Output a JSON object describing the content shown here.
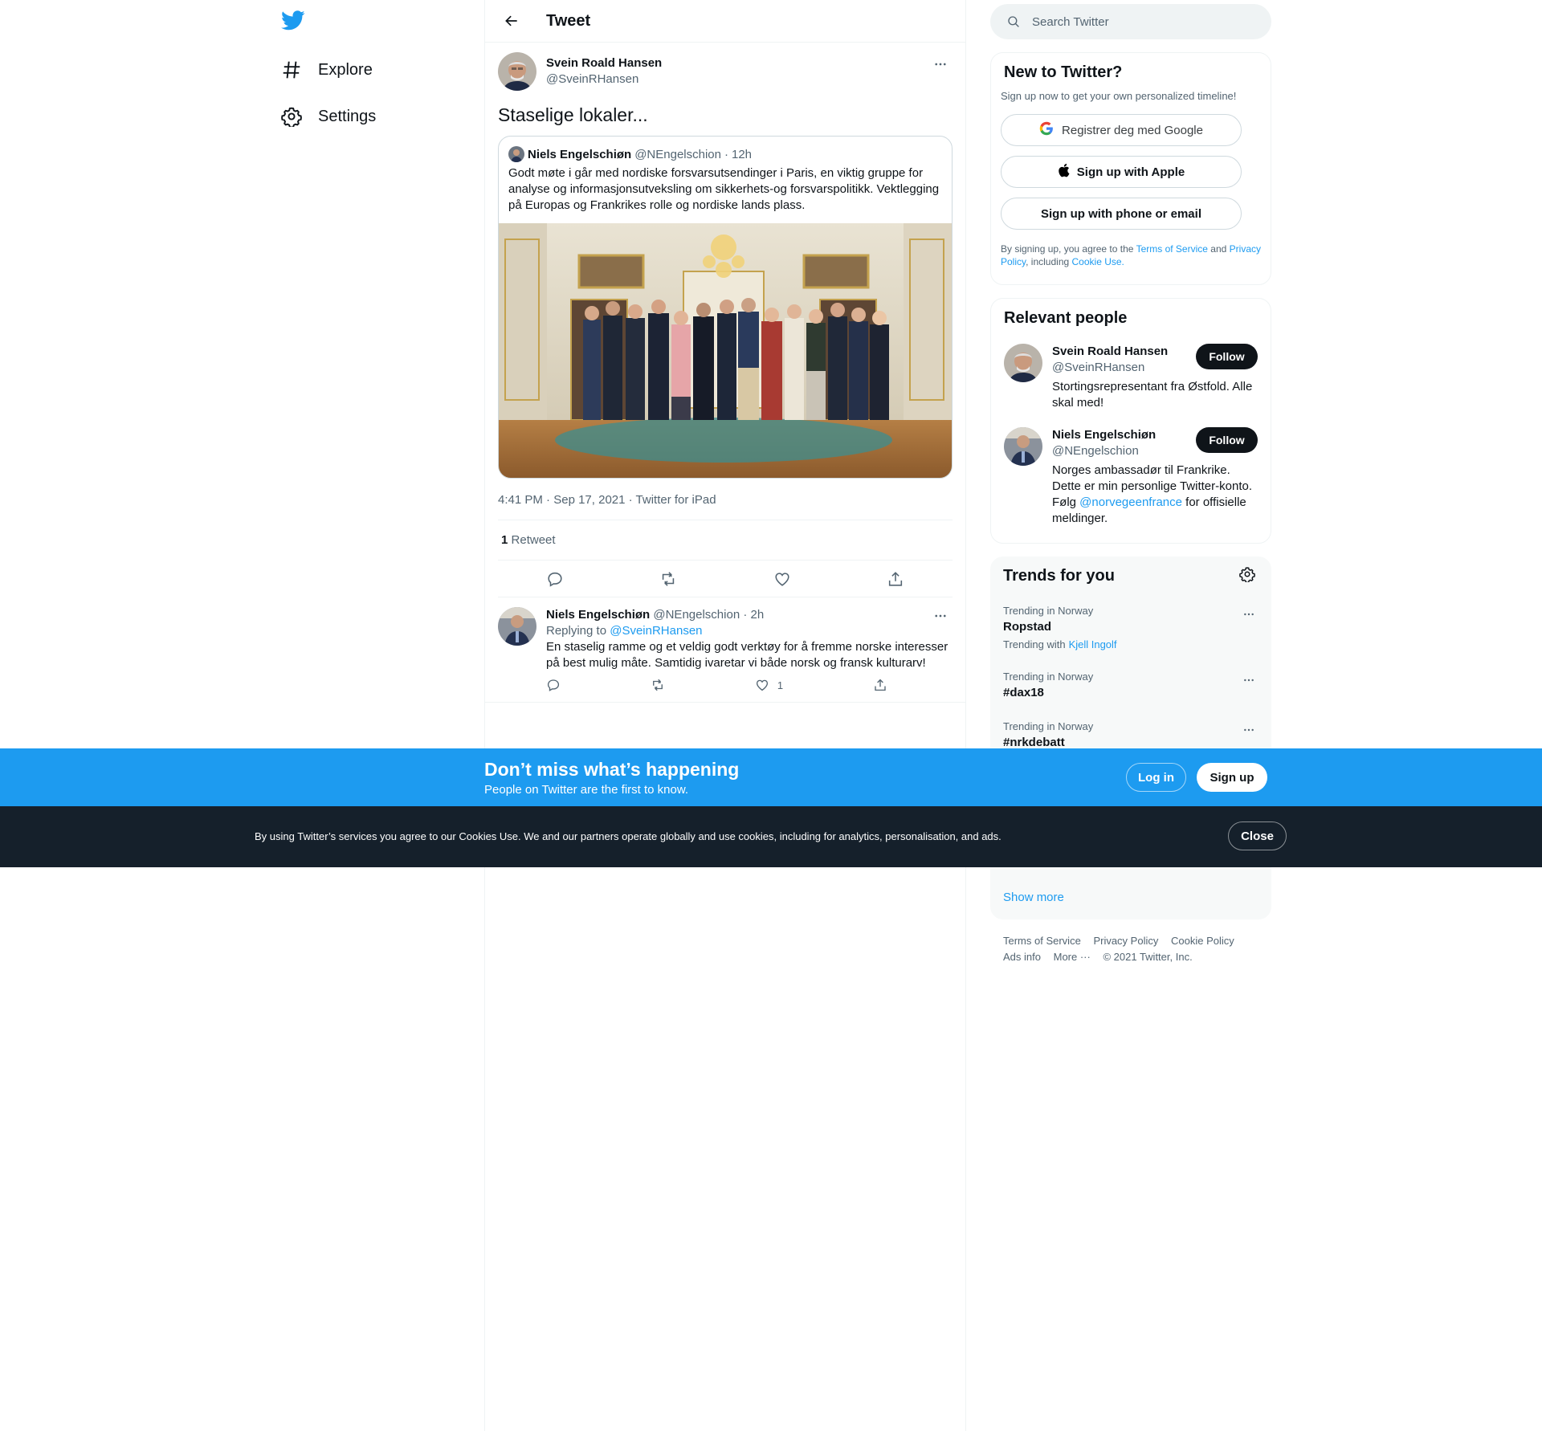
{
  "colors": {
    "brand": "#1d9bf0",
    "text": "#0f1419",
    "muted": "#536471",
    "cookie_bg": "#15202b"
  },
  "nav": {
    "items": [
      {
        "label": "Explore",
        "icon": "hashtag-icon"
      },
      {
        "label": "Settings",
        "icon": "gear-icon"
      }
    ]
  },
  "header": {
    "title": "Tweet"
  },
  "tweet": {
    "author_name": "Svein Roald Hansen",
    "author_handle": "@SveinRHansen",
    "text": "Staselige lokaler...",
    "quote": {
      "author_name": "Niels Engelschiøn",
      "author_handle": "@NEngelschion",
      "dot": "·",
      "time": "12h",
      "text": "Godt møte i går med nordiske forsvarsutsendinger i Paris, en viktig gruppe for analyse og informasjonsutveksling om sikkerhets-og forsvarspolitikk. Vektlegging på Europas og Frankrikes rolle og nordiske lands plass."
    },
    "time": "4:41 PM",
    "date": "Sep 17, 2021",
    "source": "Twitter for iPad",
    "sep": " · ",
    "retweet_count": "1",
    "retweet_label": "Retweet"
  },
  "reply": {
    "author_name": "Niels Engelschiøn",
    "author_handle": "@NEngelschion",
    "time": "· 2h",
    "replying_prefix": "Replying to",
    "replying_to": "@SveinRHansen",
    "text": "En staselig ramme og et veldig godt verktøy for å fremme norske interesser på best mulig måte. Samtidig ivaretar vi både norsk og fransk kulturarv!",
    "like_count": "1"
  },
  "search": {
    "placeholder": "Search Twitter"
  },
  "signup": {
    "title": "New to Twitter?",
    "subtitle": "Sign up now to get your own personalized timeline!",
    "google_label": "Registrer deg med Google",
    "apple_label": "Sign up with Apple",
    "phone_label": "Sign up with phone or email",
    "legal_prefix": "By signing up, you agree to the",
    "terms": "Terms of Service",
    "and": "and",
    "privacy": "Privacy Policy",
    "including": ", including",
    "cookie_use": "Cookie Use."
  },
  "relevant": {
    "title": "Relevant people",
    "follow_label": "Follow",
    "people": [
      {
        "name": "Svein Roald Hansen",
        "handle": "@SveinRHansen",
        "bio": "Stortingsrepresentant fra Østfold. Alle skal med!"
      },
      {
        "name": "Niels Engelschiøn",
        "handle": "@NEngelschion",
        "bio_prefix": "Norges ambassadør til Frankrike. Dette er min personlige Twitter-konto. Følg",
        "bio_link": "@norvegeenfrance",
        "bio_suffix": "for offisielle meldinger."
      }
    ]
  },
  "trends": {
    "title": "Trends for you",
    "items": [
      {
        "context": "Trending in Norway",
        "name": "Ropstad",
        "with_prefix": "Trending with",
        "with_link": "Kjell Ingolf"
      },
      {
        "context": "Trending in Norway",
        "name": "#dax18"
      },
      {
        "context": "Trending in Norway",
        "name": "#nrkdebatt"
      }
    ],
    "show_more": "Show more"
  },
  "footer": {
    "links": [
      "Terms of Service",
      "Privacy Policy",
      "Cookie Policy",
      "Ads info",
      "More ···",
      "© 2021 Twitter, Inc."
    ]
  },
  "banner": {
    "title": "Don’t miss what’s happening",
    "subtitle": "People on Twitter are the first to know.",
    "login": "Log in",
    "signup": "Sign up"
  },
  "cookie": {
    "text": "By using Twitter’s services you agree to our Cookies Use. We and our partners operate globally and use cookies, including for analytics, personalisation, and ads.",
    "close": "Close"
  }
}
